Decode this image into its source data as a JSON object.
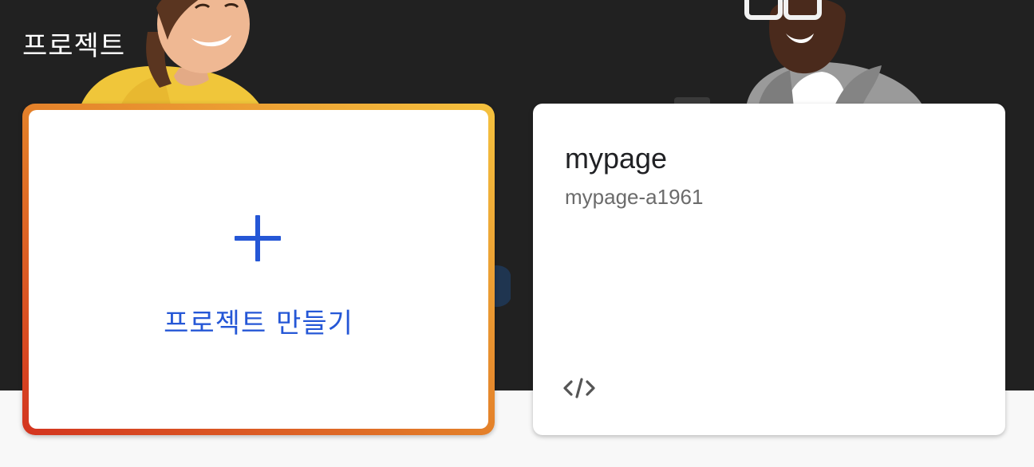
{
  "header": {
    "title": "프로젝트"
  },
  "create_card": {
    "label": "프로젝트 만들기",
    "icon": "plus-icon",
    "accent_color": "#2557d6",
    "gradient_colors": [
      "#d3341f",
      "#e27a28",
      "#f5c23e"
    ]
  },
  "projects": [
    {
      "name": "mypage",
      "id": "mypage-a1961",
      "platform_icon": "code-icon"
    }
  ],
  "colors": {
    "hero_background": "#212121",
    "page_background": "#f8f8f8"
  }
}
